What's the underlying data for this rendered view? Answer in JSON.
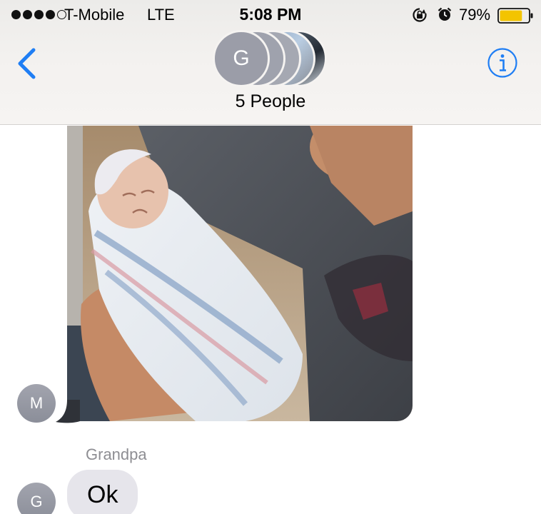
{
  "status_bar": {
    "carrier": "T-Mobile",
    "network": "LTE",
    "time": "5:08 PM",
    "battery_percent": "79%",
    "battery_level": 0.79,
    "battery_color": "#f3c400",
    "signal_bars_filled": 4,
    "signal_bars_total": 5,
    "icons": [
      "rotation-lock-icon",
      "alarm-clock-icon",
      "battery-icon"
    ]
  },
  "nav": {
    "back_icon": "chevron-left-icon",
    "info_icon": "info-circle-icon",
    "accent_color": "#1f7ef4",
    "group_avatar_initial": "G",
    "people_count_label": "5 People"
  },
  "messages": [
    {
      "type": "photo",
      "sender_initial": "M",
      "content": "image-attachment"
    },
    {
      "type": "text",
      "sender_name": "Grandpa",
      "sender_initial": "G",
      "text": "Ok"
    }
  ]
}
